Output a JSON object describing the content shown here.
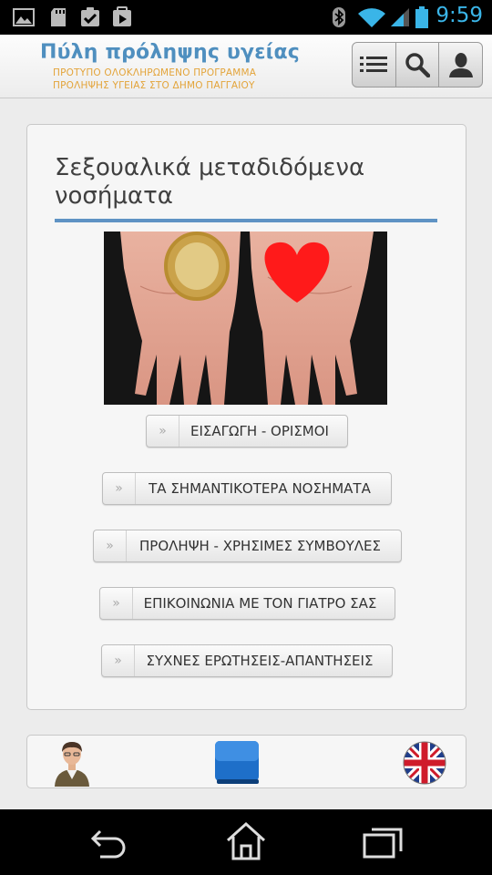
{
  "status_bar": {
    "time": "9:59",
    "icons": [
      "gallery-icon",
      "sd-card-icon",
      "checkbox-icon",
      "play-store-icon",
      "bluetooth-icon",
      "wifi-icon",
      "signal-icon",
      "battery-icon"
    ],
    "accent_color": "#3ab5e8"
  },
  "header": {
    "title": "Πύλη πρόληψης υγείας",
    "subtitle_line1": "ΠΡΟΤΥΠΟ ΟΛΟΚΛΗΡΩΜΕΝΟ ΠΡΟΓΡΑΜΜΑ",
    "subtitle_line2": "ΠΡΟΛΗΨΗΣ ΥΓΕΙΑΣ ΣΤΟ ΔΗΜΟ ΠΑΓΓΑΙΟΥ",
    "title_color": "#4f8fbf",
    "subtitle_color": "#e3a43a",
    "buttons": [
      "menu-icon",
      "search-icon",
      "user-icon"
    ]
  },
  "page": {
    "title": "Σεξουαλικά μεταδιδόμενα νοσήματα",
    "rule_color": "#5f93c4",
    "image_icon": "hands-condom-heart-photo",
    "buttons": [
      {
        "label": "ΕΙΣΑΓΩΓΗ - ΟΡΙΣΜΟΙ",
        "icon": "double-chevron-icon"
      },
      {
        "label": "ΤΑ ΣΗΜΑΝΤΙΚΟΤΕΡΑ ΝΟΣΗΜΑΤΑ",
        "icon": "double-chevron-icon"
      },
      {
        "label": "ΠΡΟΛΗΨΗ - ΧΡΗΣΙΜΕΣ ΣΥΜΒΟΥΛΕΣ",
        "icon": "double-chevron-icon"
      },
      {
        "label": "ΕΠΙΚΟΙΝΩΝΙΑ ΜΕ ΤΟΝ ΓΙΑΤΡΟ ΣΑΣ",
        "icon": "double-chevron-icon"
      },
      {
        "label": "ΣΥΧΝΕΣ ΕΡΩΤΗΣΕΙΣ-ΑΠΑΝΤΗΣΕΙΣ",
        "icon": "double-chevron-icon"
      }
    ]
  },
  "footer": {
    "icons": [
      "doctor-avatar-icon",
      "book-icon",
      "uk-flag-icon"
    ]
  },
  "system_nav": {
    "icons": [
      "back-icon",
      "home-icon",
      "recent-apps-icon"
    ]
  }
}
